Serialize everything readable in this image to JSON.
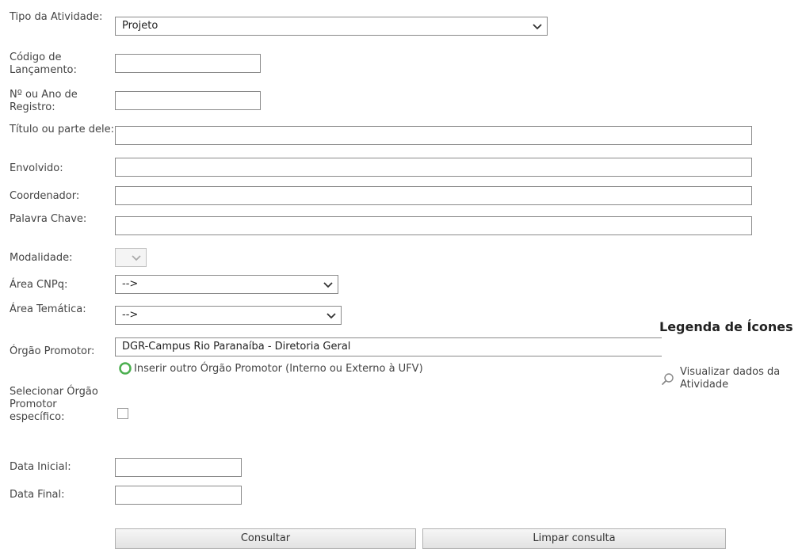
{
  "form": {
    "tipo_label": "Tipo da Atividade:",
    "tipo_value": "Projeto",
    "codigo_label": "Código de Lançamento:",
    "codigo_value": "",
    "numero_label": "Nº ou Ano de Registro:",
    "numero_value": "",
    "titulo_label": "Título ou parte dele:",
    "titulo_value": "",
    "envolvido_label": "Envolvido:",
    "envolvido_value": "",
    "coordenador_label": "Coordenador:",
    "coordenador_value": "",
    "palavra_label": "Palavra Chave:",
    "palavra_value": "",
    "modalidade_label": "Modalidade:",
    "area_cnpq_label": "Área CNPq:",
    "area_cnpq_value": "-->",
    "area_tematica_label": "Área Temática:",
    "area_tematica_value": "-->",
    "orgao_label": "Órgão Promotor:",
    "orgao_value": "DGR-Campus Rio Paranaíba - Diretoria Geral",
    "inserir_orgao_link": "Inserir outro Órgão Promotor (Interno ou Externo à UFV)",
    "selecionar_label": "Selecionar Órgão Promotor específico:",
    "data_inicial_label": "Data Inicial:",
    "data_inicial_value": "",
    "data_final_label": "Data Final:",
    "data_final_value": ""
  },
  "buttons": {
    "consultar": "Consultar",
    "limpar": "Limpar consulta"
  },
  "legend": {
    "title": "Legenda de Ícones",
    "items": [
      {
        "icon": "magnifier-icon",
        "label": "Visualizar dados da Atividade"
      }
    ]
  },
  "colors": {
    "border": "#8a8a8a",
    "link_icon": "#4caf50"
  }
}
